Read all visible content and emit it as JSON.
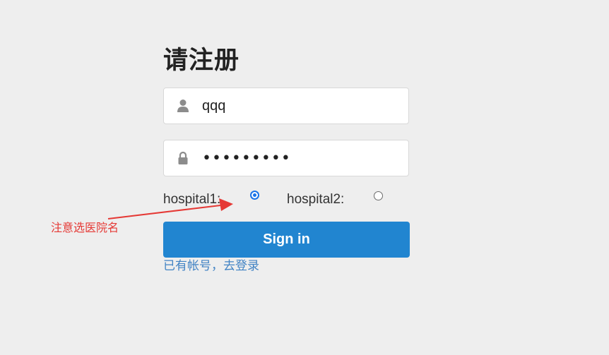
{
  "form": {
    "title": "请注册",
    "username": {
      "value": "qqq",
      "icon": "user-icon"
    },
    "password": {
      "value": "•••••••••",
      "icon": "lock-icon"
    },
    "hospital_options": [
      {
        "label": "hospital1:",
        "selected": true
      },
      {
        "label": "hospital2:",
        "selected": false
      }
    ],
    "submit_label": "Sign in",
    "login_link": "已有帐号，去登录"
  },
  "annotation": {
    "text": "注意选医院名",
    "color": "#e53935"
  },
  "colors": {
    "background": "#eeeeee",
    "primary_button": "#2185d0",
    "link": "#4183c4",
    "radio_selected": "#1a73e8"
  }
}
